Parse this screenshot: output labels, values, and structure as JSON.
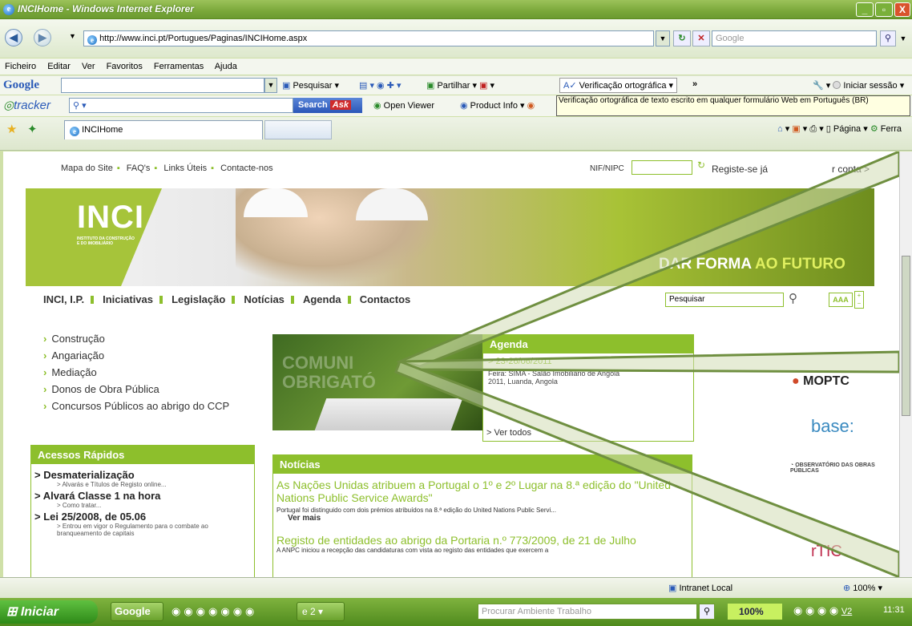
{
  "window": {
    "title": "INCIHome - Windows Internet Explorer",
    "controls": [
      "_",
      "▫",
      "X"
    ]
  },
  "address": {
    "url": "http://www.inci.pt/Portugues/Paginas/INCIHome.aspx",
    "search_placeholder": "Google"
  },
  "menu": [
    "Ficheiro",
    "Editar",
    "Ver",
    "Favoritos",
    "Ferramentas",
    "Ajuda"
  ],
  "google_toolbar": {
    "brand": "Google",
    "search_label": "Pesquisar",
    "share_label": "Partilhar",
    "spell_label": "Verificação ortográfica",
    "more": "»",
    "signin_label": "Iniciar sessão"
  },
  "tracker_toolbar": {
    "brand": "tracker",
    "search_button": "Search",
    "ask": "Ask",
    "open_viewer": "Open Viewer",
    "product_info": "Product Info",
    "tooltip": "Verificação ortográfica de texto escrito em qualquer formulário Web em Português (BR)"
  },
  "fav_bar": {
    "tab_label": "INCIHome",
    "page_label": "Página",
    "tools_label": "Ferra"
  },
  "site": {
    "toplinks": [
      "Mapa do Site",
      "FAQ's",
      "Links Úteis",
      "Contacte-nos"
    ],
    "nif_label": "NIF/NIPC",
    "register": "Registe-se já",
    "account": "r conta >",
    "logo": "INCI",
    "logo_sub1": "INSTITUTO DA CONSTRUÇÃO",
    "logo_sub2": "E DO IMOBILIÁRIO",
    "slogan_a": "DAR FORMA",
    "slogan_b": "AO FUTURO",
    "nav": [
      "INCI, I.P.",
      "Iniciativas",
      "Legislação",
      "Notícias",
      "Agenda",
      "Contactos"
    ],
    "search_value": "Pesquisar",
    "font_btn": "AAA",
    "left_items": [
      "Construção",
      "Angariação",
      "Mediação",
      "Donos de Obra Pública",
      "Concursos Públicos ao abrigo do CCP"
    ],
    "quick_access": {
      "header": "Acessos Rápidos",
      "items": [
        {
          "title": "> Desmaterialização",
          "sub": "> Alvarás e Títulos de Registo online..."
        },
        {
          "title": "> Alvará Classe 1 na hora",
          "sub": "> Como tratar..."
        },
        {
          "title": "> Lei 25/2008, de 05.06",
          "sub": "> Entrou em vigor o Regulamento para o combate ao branqueamento de capitais"
        }
      ]
    },
    "promo_text": "COMUNI OBRIGATÓ",
    "agenda": {
      "header": "Agenda",
      "date": "> 23-26/06/2011",
      "text": "Feira: SIMA - Salão Imobiliário de Angola 2011, Luanda, Angola",
      "more": "> Ver todos"
    },
    "news": {
      "header": "Notícias",
      "item1_title": "As Nações Unidas atribuem a Portugal o 1º e 2º Lugar na 8.ª edição do \"United Nations Public Service Awards\"",
      "item1_text": "Portugal foi distinguido com dois prémios atribuídos na 8.ª edição do United Nations Public Servi...",
      "item1_more": "Ver mais",
      "item2_title": "Registo de entidades ao abrigo da Portaria n.º 773/2009, de 21 de Julho",
      "item2_text": "A ANPC iniciou a recepção das candidaturas com vista ao registo das entidades que exercem a"
    },
    "partners": [
      "MOPTC",
      "base:",
      "OBSERVATÓRIO DAS OBRAS PÚBLICAS",
      "rTIC"
    ]
  },
  "status": {
    "zone": "Intranet Local",
    "zoom": "100%"
  },
  "taskbar": {
    "start": "Iniciar",
    "google": "Google",
    "ie_count": "2",
    "search_placeholder": "Procurar Ambiente Trabalho",
    "battery": "100%",
    "clock": "11:31",
    "v2": "V2"
  }
}
